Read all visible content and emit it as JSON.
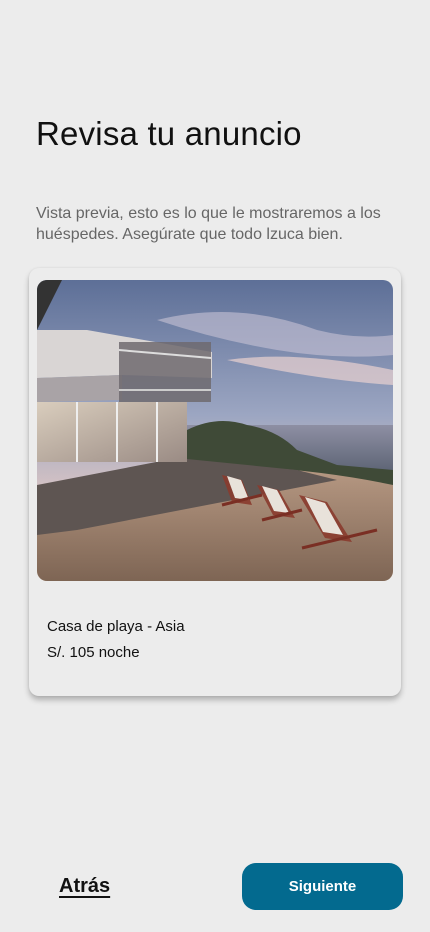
{
  "page": {
    "title": "Revisa tu anuncio",
    "subtitle": "Vista previa, esto es lo que le mostraremos a los huéspedes. Asegúrate que todo lzuca bien."
  },
  "listing": {
    "image_alt": "",
    "name": "Casa de playa - Asia",
    "price": "S/. 105",
    "price_unit": "noche"
  },
  "footer": {
    "back_label": "Atrás",
    "next_label": "Siguiente"
  },
  "colors": {
    "background": "#ececec",
    "primary": "#036a8f"
  }
}
